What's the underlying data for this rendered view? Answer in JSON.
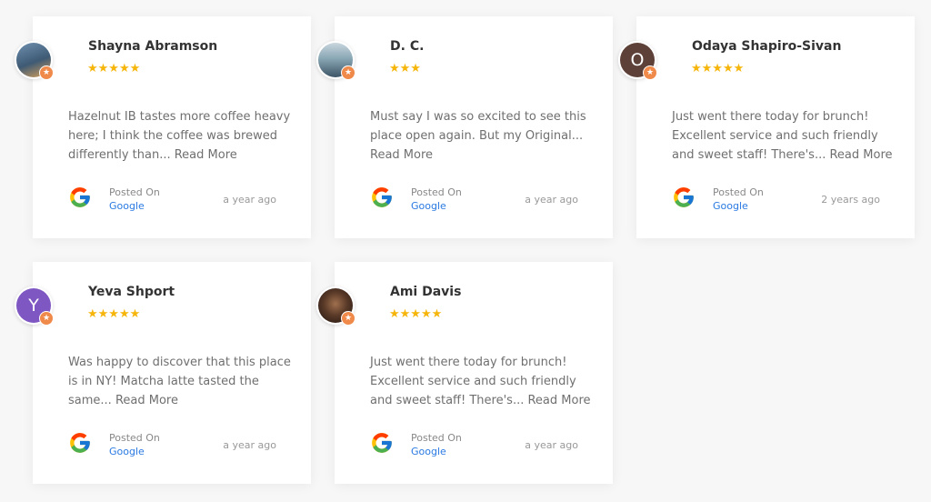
{
  "reviews": [
    {
      "name": "Shayna Abramson",
      "avatar_type": "photo",
      "avatar_color": "#4a6e8f",
      "avatar_initial": "",
      "rating": 5,
      "stars": "★★★★★",
      "text": "Hazelnut IB tastes more coffee heavy here; I think the coffee was brewed differently than...",
      "read_more": "Read More",
      "posted_label": "Posted On",
      "source": "Google",
      "time": "a year ago"
    },
    {
      "name": "D. C.",
      "avatar_type": "photo",
      "avatar_color": "#7b98a6",
      "avatar_initial": "",
      "rating": 3,
      "stars": "★★★",
      "text": "Must say I was so excited to see this place open again. But my Original...",
      "read_more": "Read More",
      "posted_label": "Posted On",
      "source": "Google",
      "time": "a year ago"
    },
    {
      "name": "Odaya Shapiro-Sivan",
      "avatar_type": "initial",
      "avatar_color": "#5d4037",
      "avatar_initial": "O",
      "rating": 5,
      "stars": "★★★★★",
      "text": "Just went there today for brunch! Excellent service and such friendly and sweet staff! There's...",
      "read_more": "Read More",
      "posted_label": "Posted On",
      "source": "Google",
      "time": "2 years ago"
    },
    {
      "name": "Yeva Shport",
      "avatar_type": "initial",
      "avatar_color": "#7e57c2",
      "avatar_initial": "Y",
      "rating": 5,
      "stars": "★★★★★",
      "text": "Was happy to discover that this place is in NY! Matcha latte tasted the same...",
      "read_more": "Read More",
      "posted_label": "Posted On",
      "source": "Google",
      "time": "a year ago"
    },
    {
      "name": "Ami Davis",
      "avatar_type": "photo",
      "avatar_color": "#3b2a22",
      "avatar_initial": "",
      "rating": 5,
      "stars": "★★★★★",
      "text": "Just went there today for brunch! Excellent service and such friendly and sweet staff! There's...",
      "read_more": "Read More",
      "posted_label": "Posted On",
      "source": "Google",
      "time": "a year ago"
    }
  ]
}
